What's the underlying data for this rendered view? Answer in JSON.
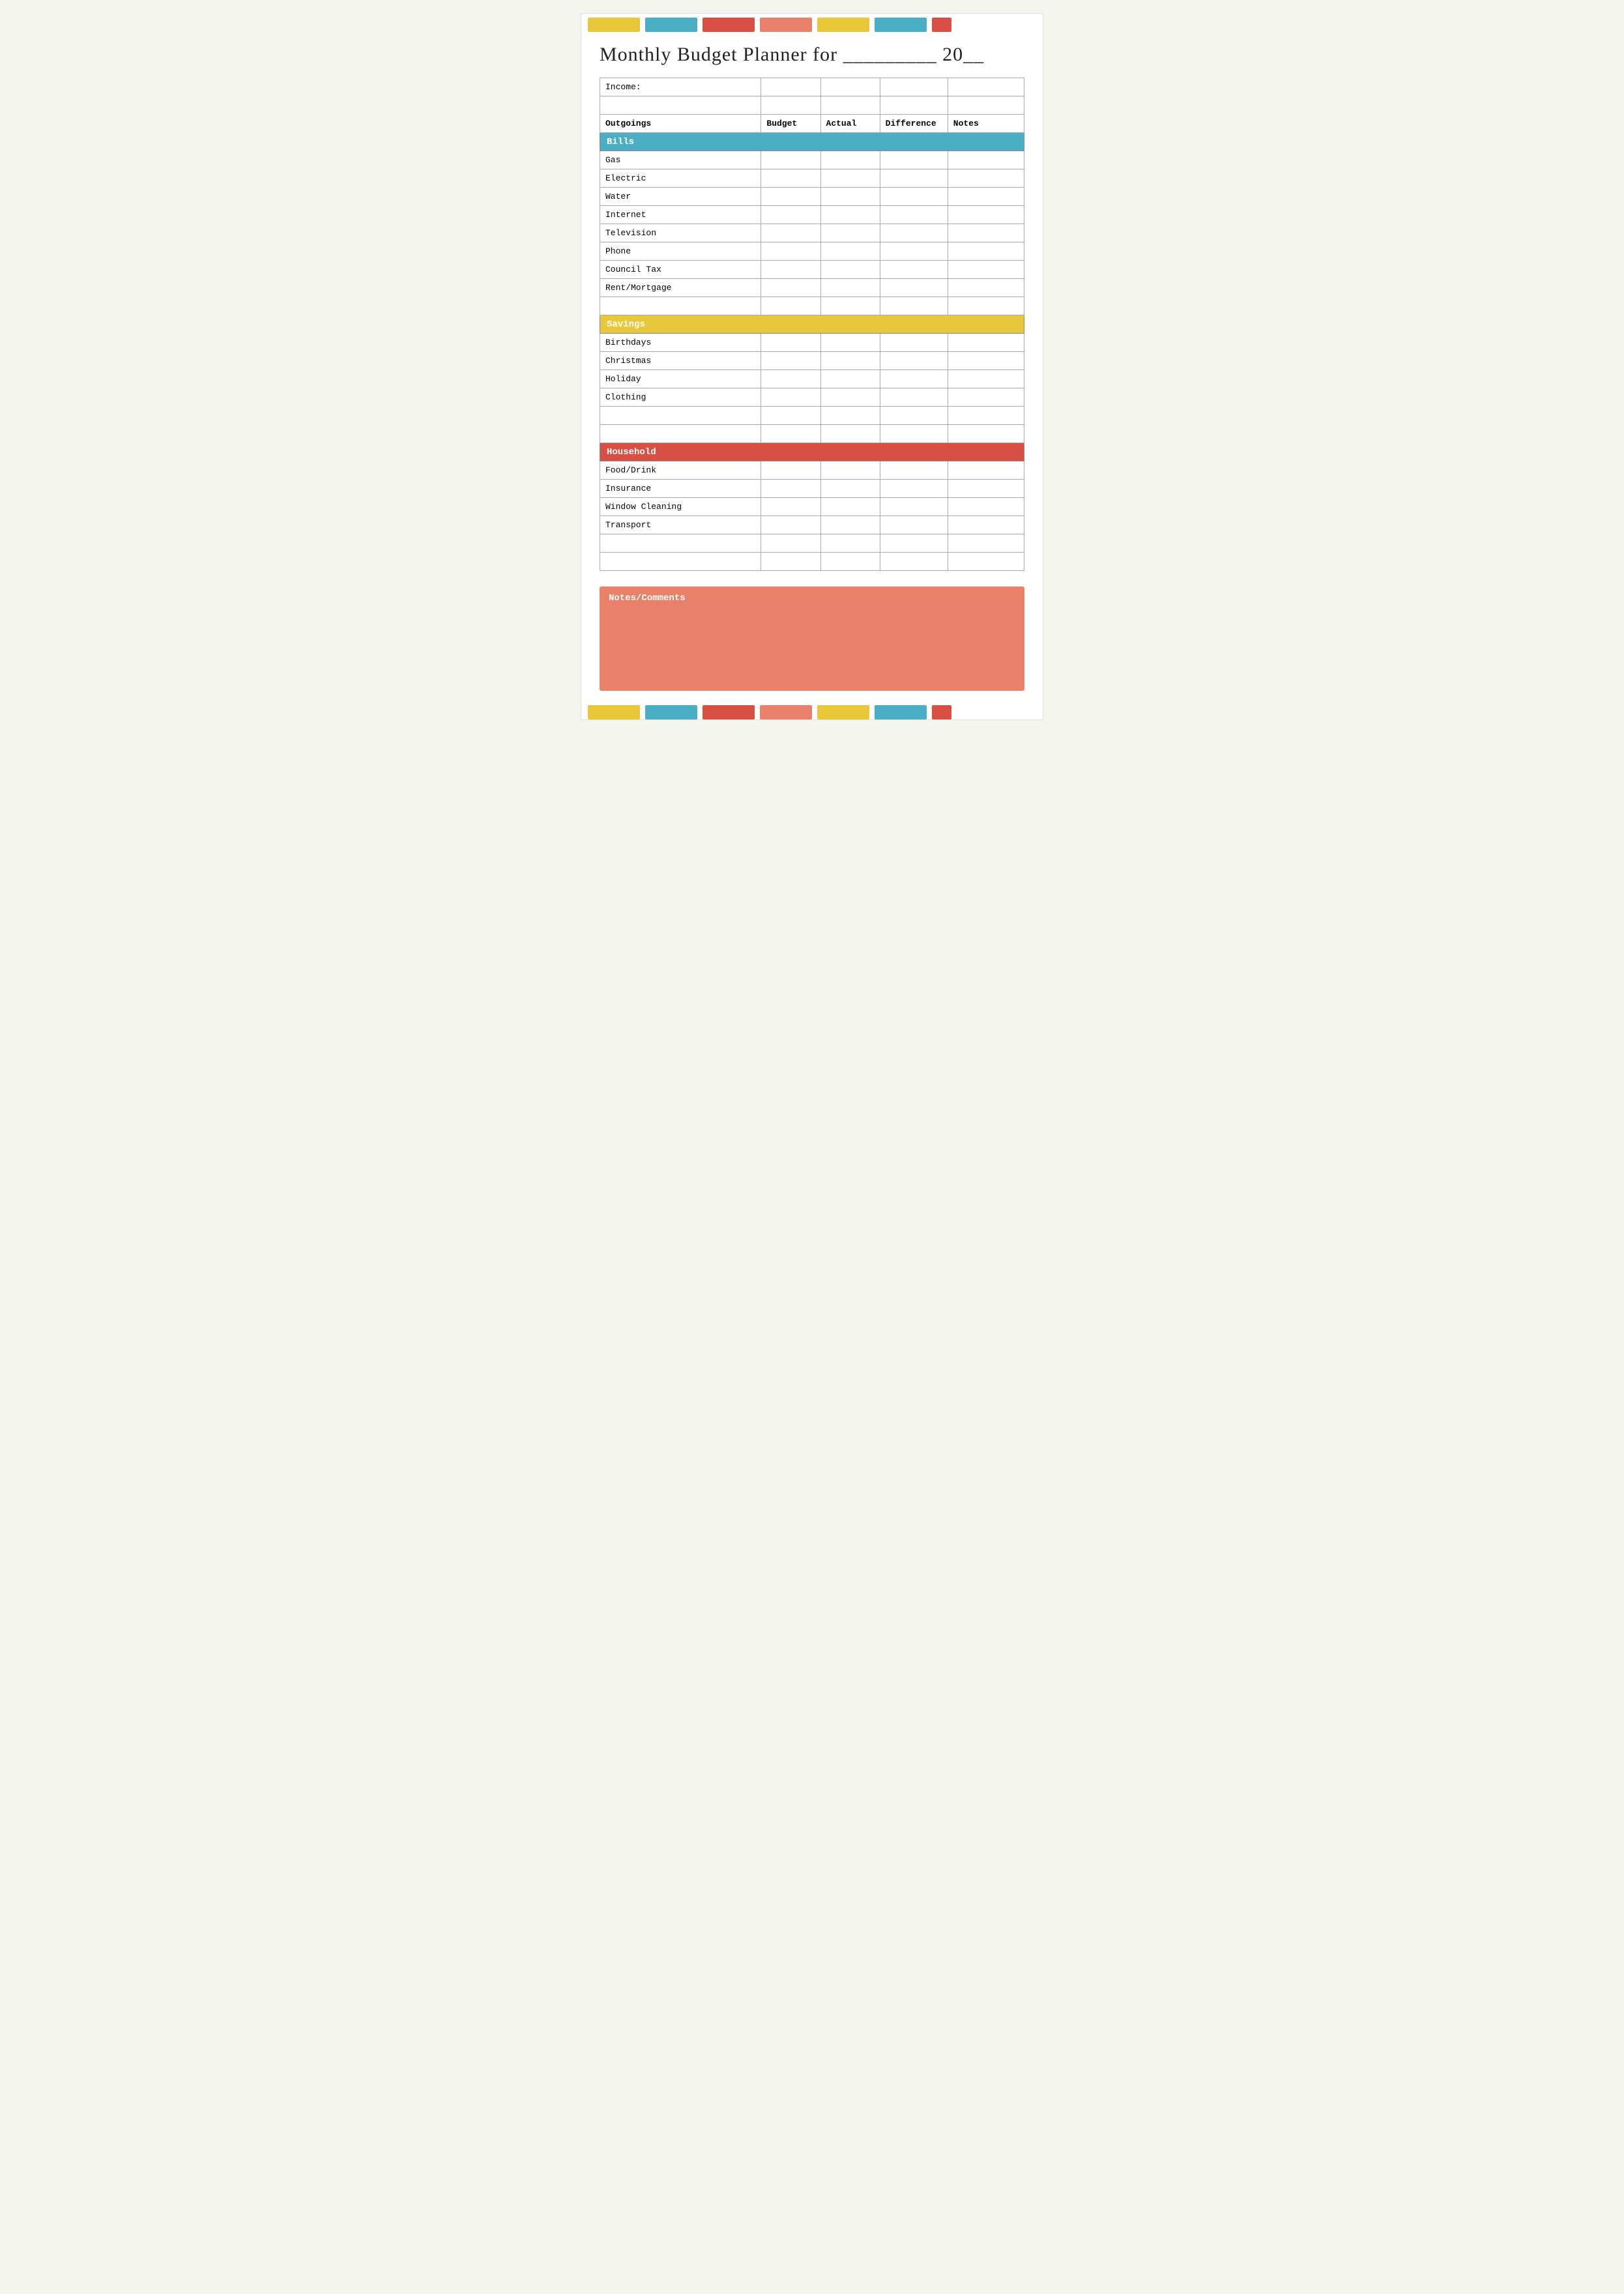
{
  "topBar": {
    "blocks": [
      {
        "color": "#e8c73a",
        "width": 80
      },
      {
        "color": "#4aaec4",
        "width": 80
      },
      {
        "color": "#d94f44",
        "width": 80
      },
      {
        "color": "#e8806a",
        "width": 80
      },
      {
        "color": "#e8c73a",
        "width": 80
      },
      {
        "color": "#4aaec4",
        "width": 80
      },
      {
        "color": "#d94f44",
        "width": 30
      }
    ]
  },
  "title": "Monthly Budget Planner for _________ 20__",
  "table": {
    "incomeLabel": "Income:",
    "columns": [
      "Outgoings",
      "Budget",
      "Actual",
      "Difference",
      "Notes"
    ],
    "sections": [
      {
        "header": "Bills",
        "headerClass": "bills-header",
        "rows": [
          "Gas",
          "Electric",
          "Water",
          "Internet",
          "Television",
          "Phone",
          "Council Tax",
          "Rent/Mortgage",
          ""
        ]
      },
      {
        "header": "Savings",
        "headerClass": "savings-header",
        "rows": [
          "Birthdays",
          "Christmas",
          "Holiday",
          "Clothing",
          "",
          ""
        ]
      },
      {
        "header": "Household",
        "headerClass": "household-header",
        "rows": [
          "Food/Drink",
          "Insurance",
          "Window Cleaning",
          "Transport",
          "",
          ""
        ]
      }
    ]
  },
  "notes": {
    "label": "Notes/Comments"
  },
  "bottomBar": {
    "blocks": [
      {
        "color": "#e8c73a",
        "width": 80
      },
      {
        "color": "#4aaec4",
        "width": 80
      },
      {
        "color": "#d94f44",
        "width": 80
      },
      {
        "color": "#e8806a",
        "width": 80
      },
      {
        "color": "#e8c73a",
        "width": 80
      },
      {
        "color": "#4aaec4",
        "width": 80
      },
      {
        "color": "#d94f44",
        "width": 30
      }
    ]
  }
}
